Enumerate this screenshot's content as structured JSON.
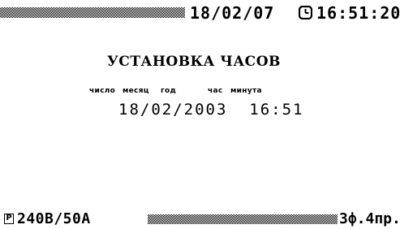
{
  "status_bar": {
    "date": "18/02/07",
    "clock_icon": "clock-icon",
    "time": "16:51:20"
  },
  "main": {
    "title": "УСТАНОВКА ЧАСОВ",
    "labels": {
      "day": "число",
      "month": "месяц",
      "year": "год",
      "hour": "час",
      "minute": "минута"
    },
    "value": "18/02/2003  16:51"
  },
  "bottom_bar": {
    "p_icon": "Р",
    "mode": "240В/50А",
    "phases": "3ф.4пр."
  },
  "colors": {
    "background": "#ffffff",
    "foreground": "#000000"
  }
}
